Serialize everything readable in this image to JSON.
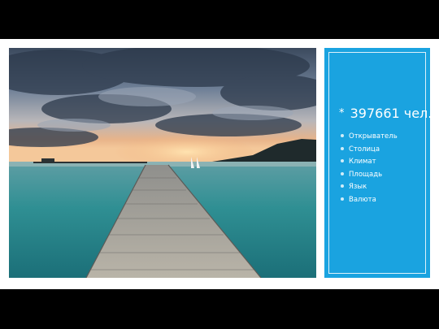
{
  "slide": {
    "photo": {
      "alt": "pier-over-sea-at-sunset"
    },
    "panel": {
      "headline": "397661 чел.",
      "bullet_marker": "*",
      "items": [
        {
          "label": "Открыватель"
        },
        {
          "label": "Столица"
        },
        {
          "label": "Климат"
        },
        {
          "label": "Площадь"
        },
        {
          "label": "Язык"
        },
        {
          "label": "Валюта"
        }
      ]
    }
  },
  "colors": {
    "panel": "#1aa3e0",
    "background": "#000000",
    "slide": "#ffffff",
    "text": "#ffffff"
  }
}
